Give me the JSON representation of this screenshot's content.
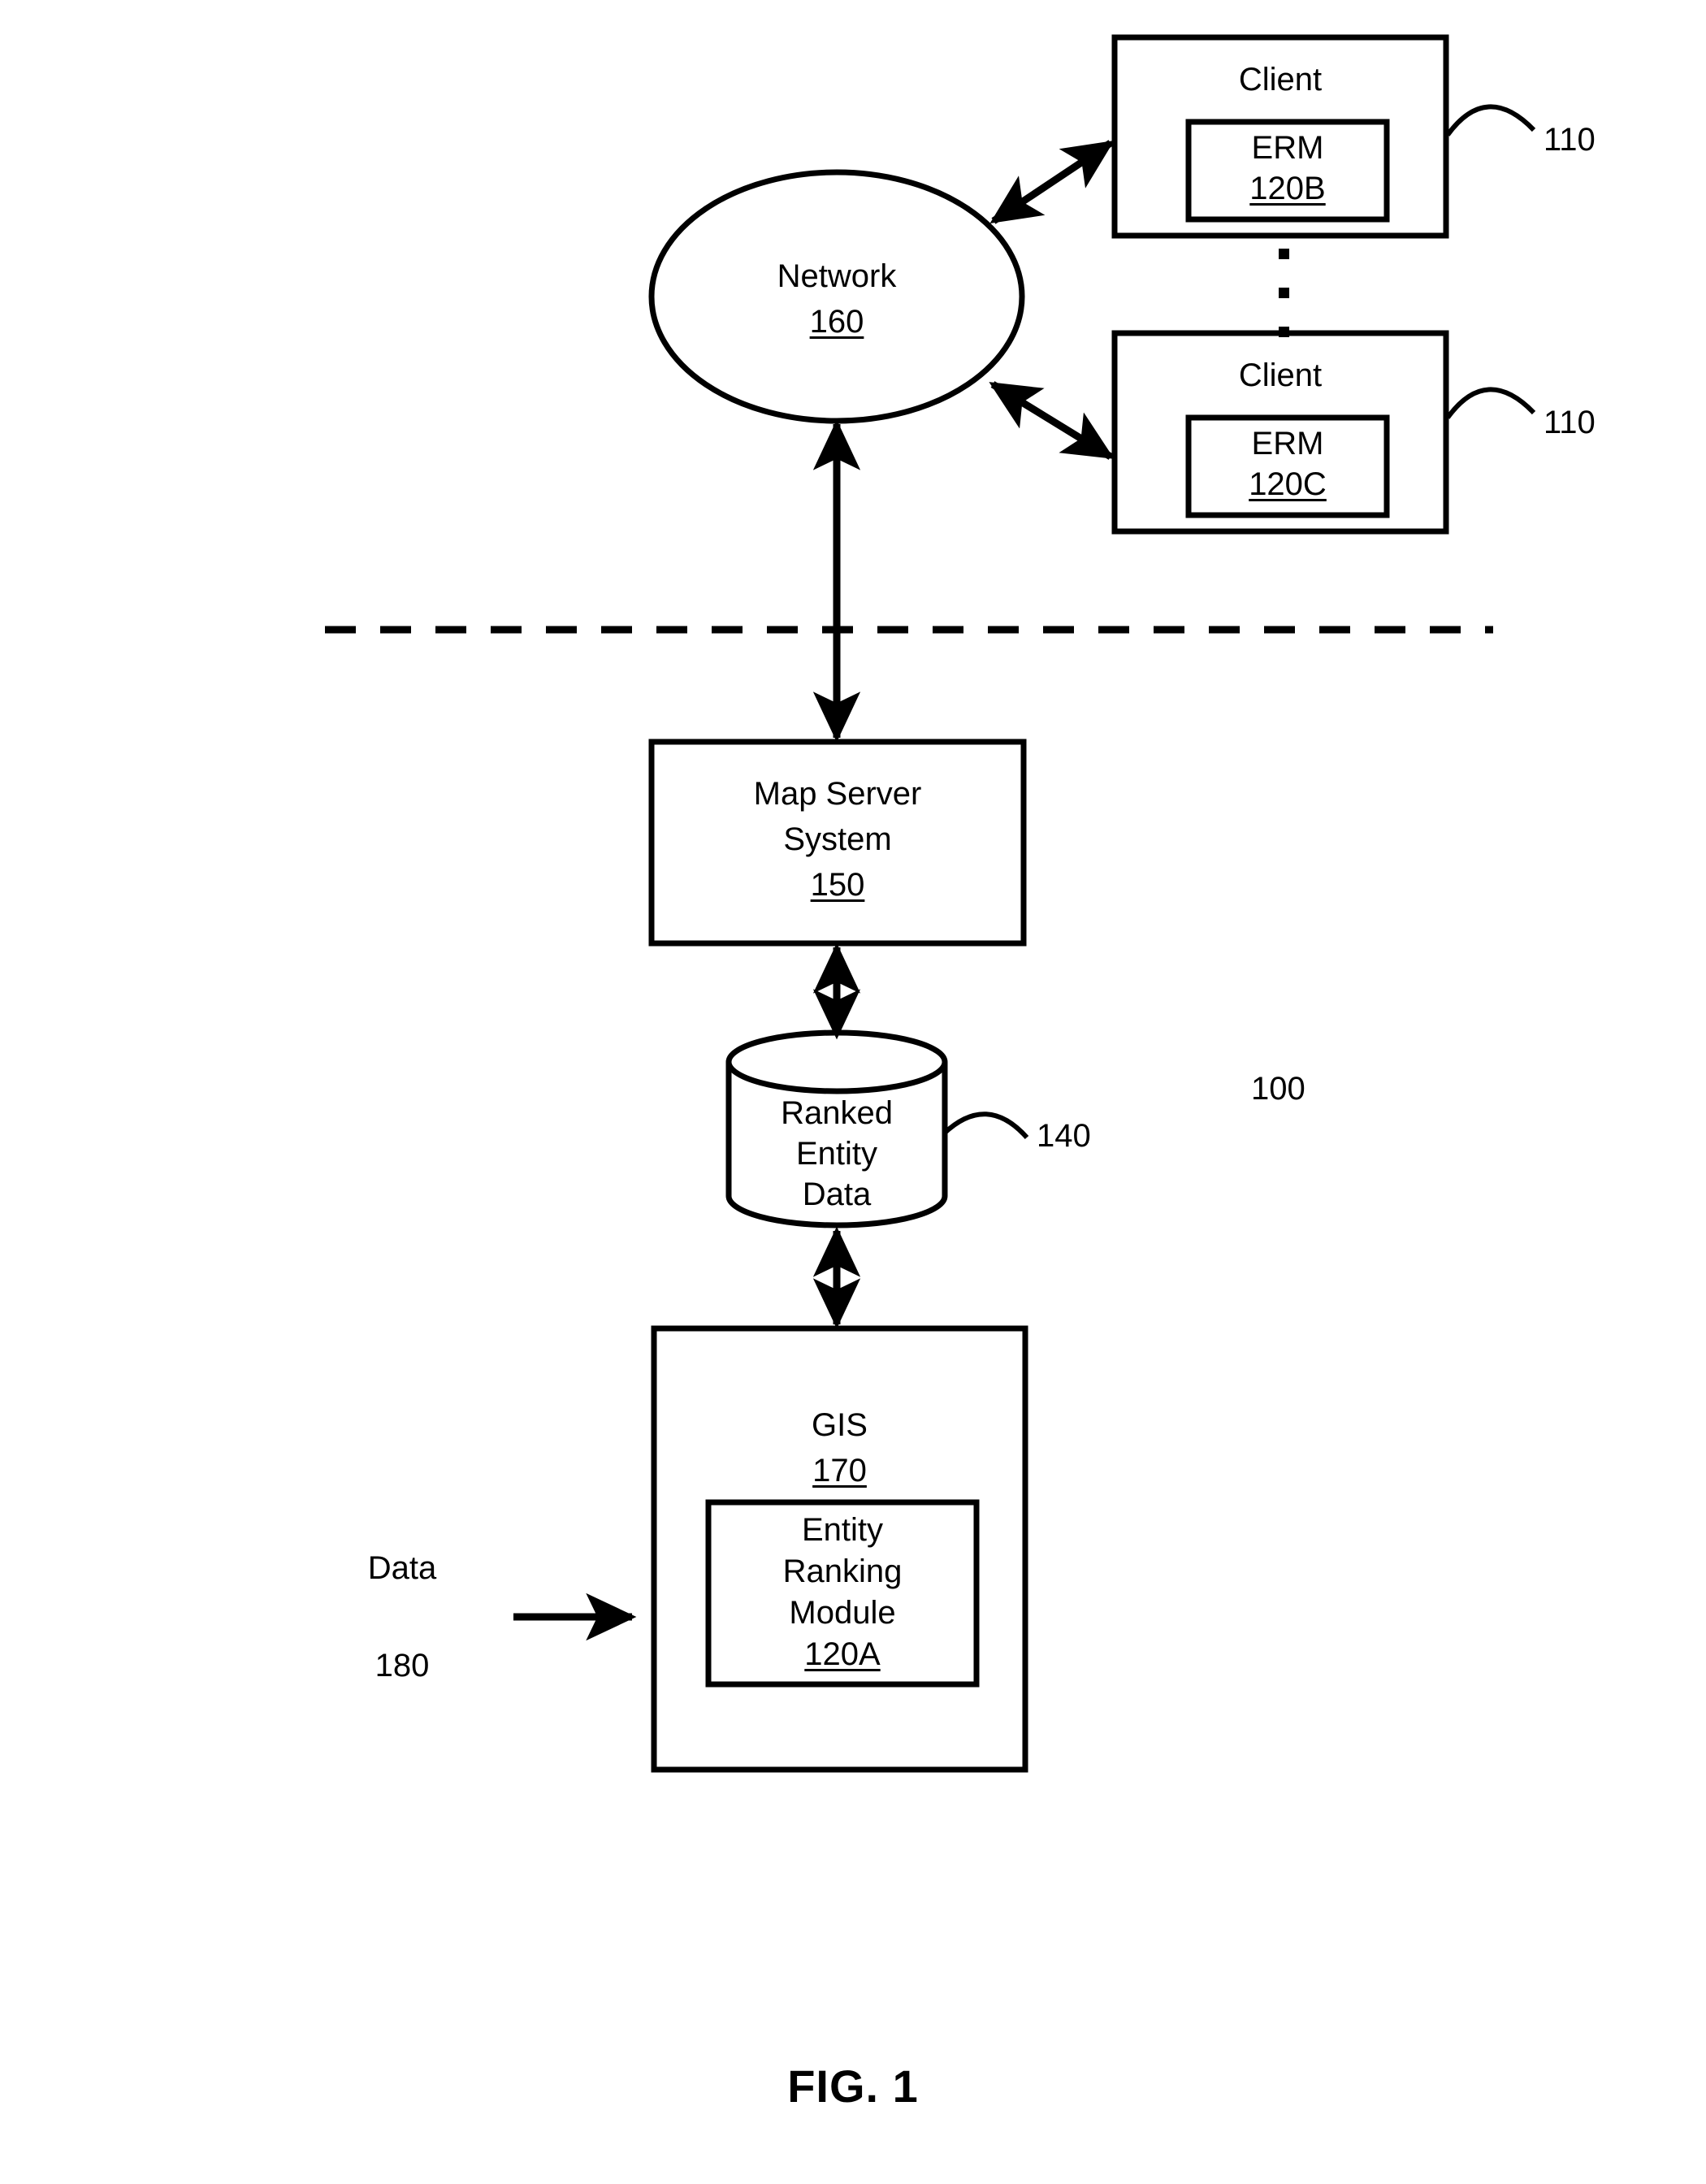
{
  "figure": {
    "caption": "FIG. 1",
    "system_ref": "100"
  },
  "nodes": {
    "client_top": {
      "title": "Client",
      "ref": "110",
      "module": {
        "title": "ERM",
        "ref": "120B"
      }
    },
    "client_bottom": {
      "title": "Client",
      "ref": "110",
      "module": {
        "title": "ERM",
        "ref": "120C"
      }
    },
    "network": {
      "title": "Network",
      "ref": "160"
    },
    "map_server": {
      "title_line1": "Map Server",
      "title_line2": "System",
      "ref": "150"
    },
    "ranked_entity_data": {
      "title_line1": "Ranked",
      "title_line2": "Entity",
      "title_line3": "Data",
      "ref": "140"
    },
    "gis": {
      "title": "GIS",
      "ref": "170",
      "module": {
        "title_line1": "Entity",
        "title_line2": "Ranking",
        "title_line3": "Module",
        "ref": "120A"
      }
    },
    "data_input": {
      "label": "Data",
      "ref": "180"
    }
  },
  "ellipsis": {
    "symbol": "·"
  },
  "style": {
    "stroke": "#000000",
    "background": "#ffffff"
  }
}
